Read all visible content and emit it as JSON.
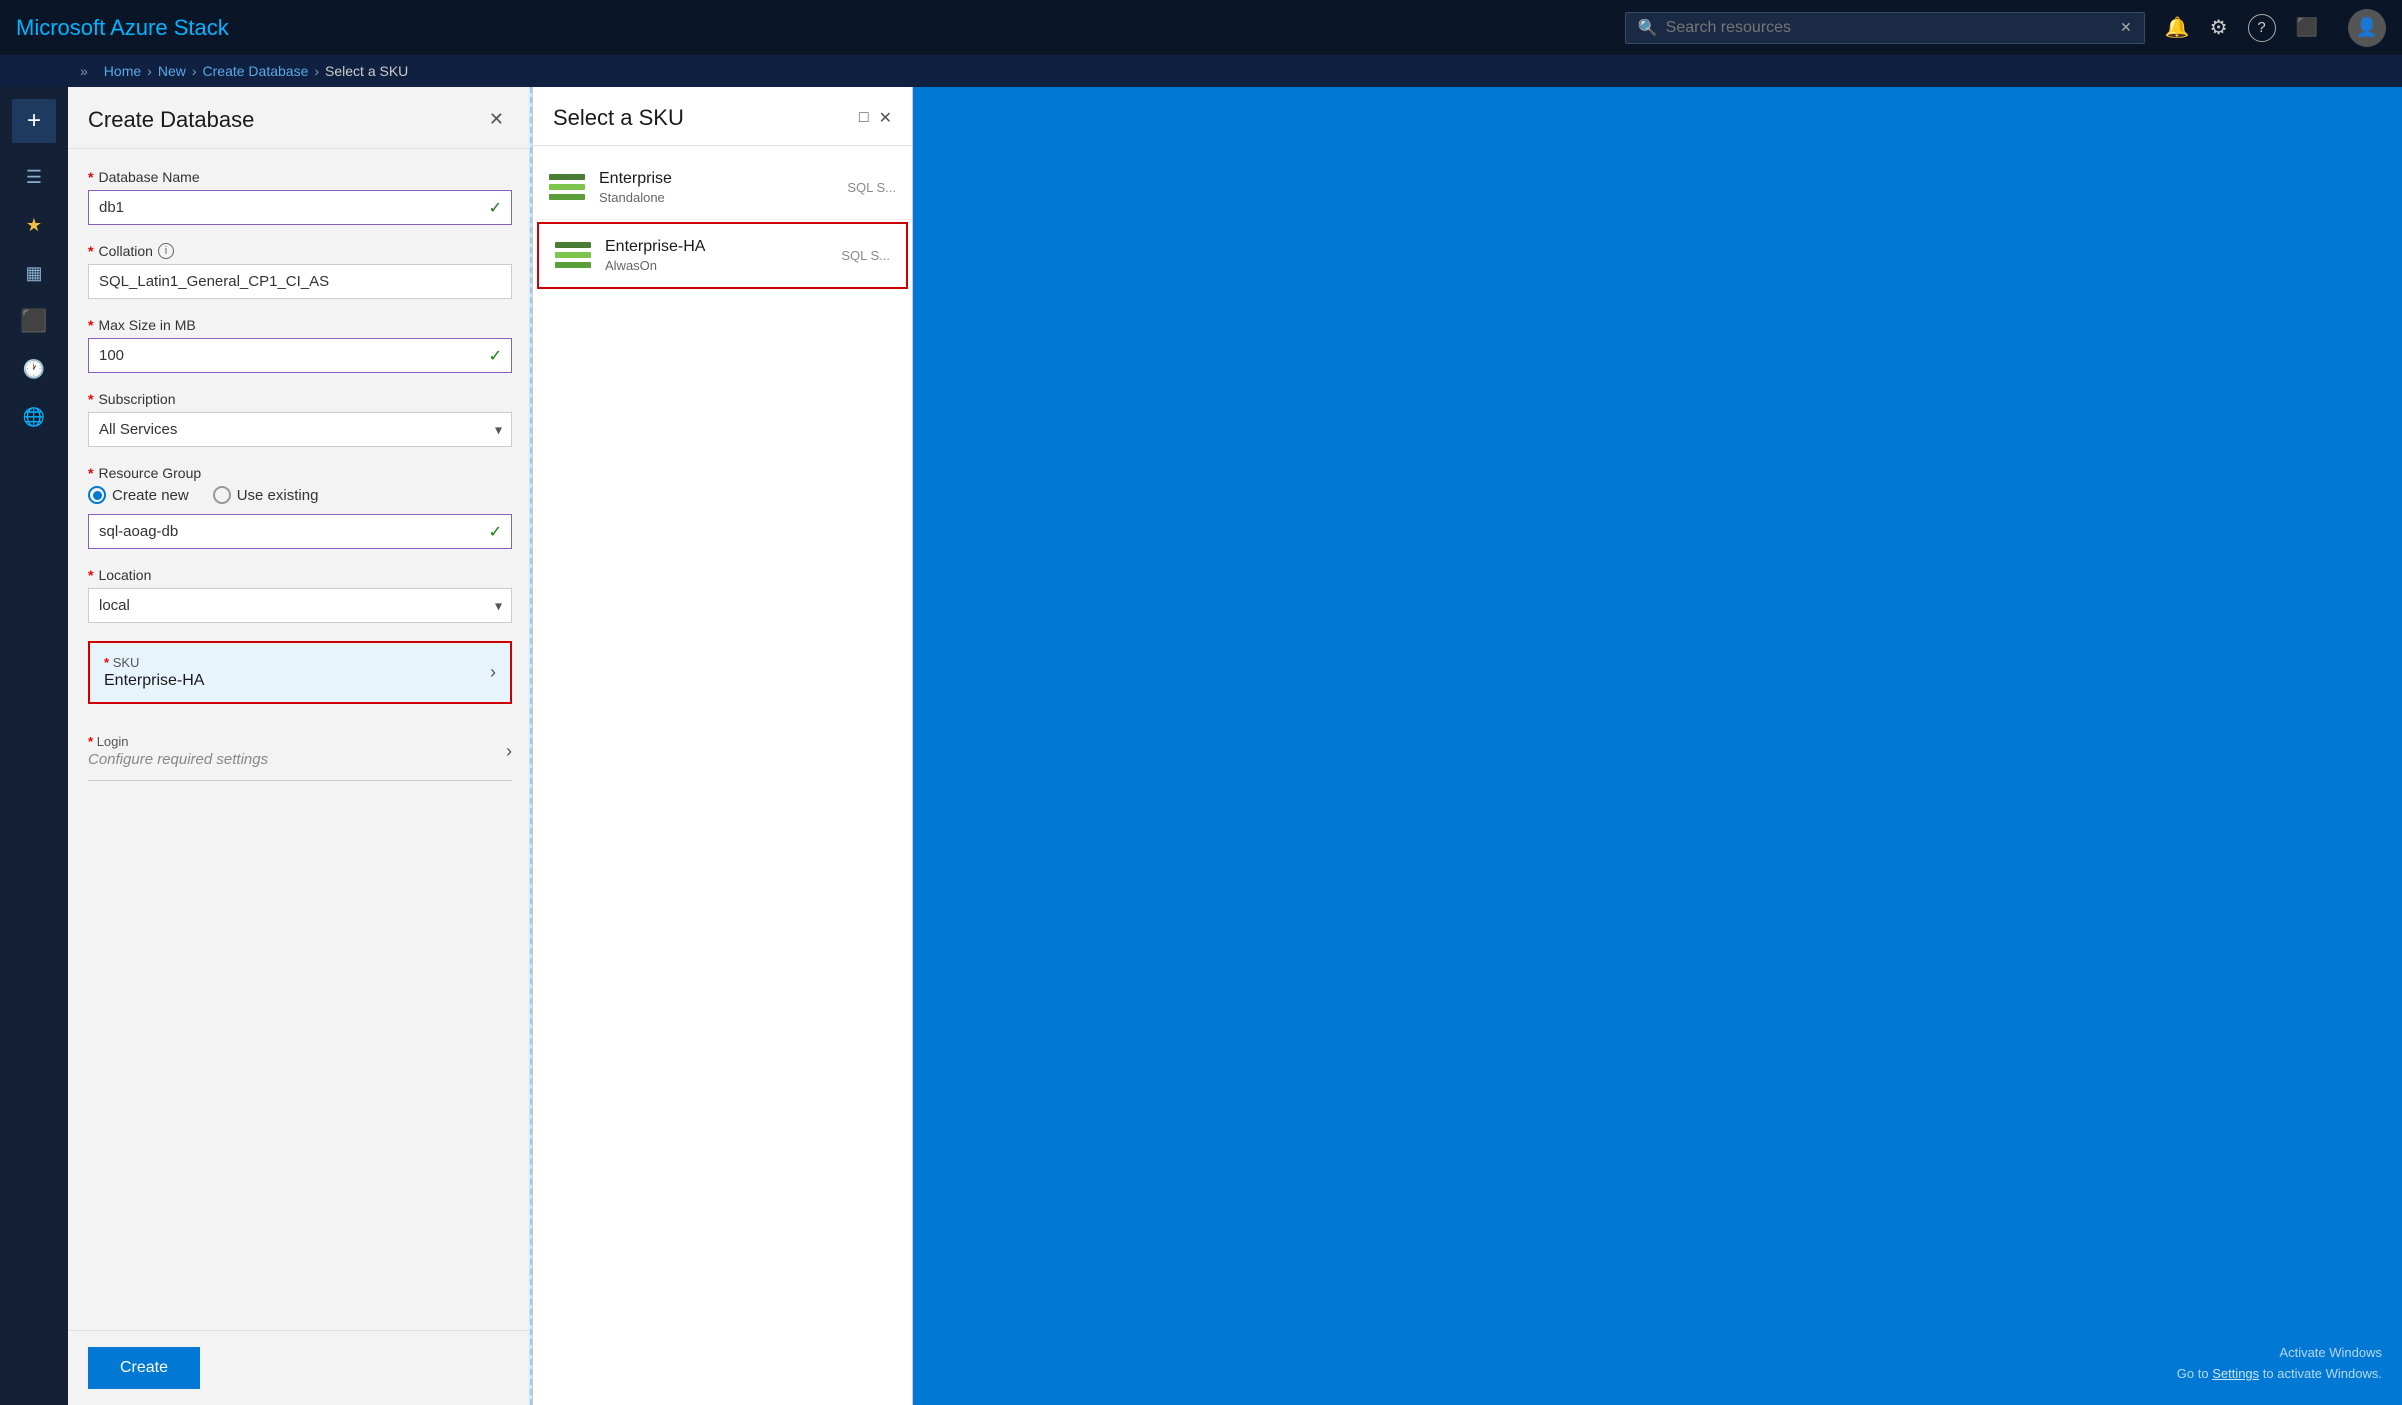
{
  "topbar": {
    "title": "Microsoft Azure Stack",
    "search_placeholder": "Search resources",
    "icons": {
      "bell": "🔔",
      "gear": "⚙",
      "help": "?",
      "portal": "⬛"
    }
  },
  "breadcrumb": {
    "expand": "»",
    "items": [
      "Home",
      "New",
      "Create Database",
      "Select a SKU"
    ]
  },
  "sidebar": {
    "add_label": "+",
    "items": [
      {
        "name": "hamburger",
        "icon": "☰"
      },
      {
        "name": "star",
        "icon": "★"
      },
      {
        "name": "dashboard",
        "icon": "▦"
      },
      {
        "name": "blocks",
        "icon": "⬛"
      },
      {
        "name": "clock",
        "icon": "🕐"
      },
      {
        "name": "globe",
        "icon": "🌐"
      }
    ]
  },
  "create_database_panel": {
    "title": "Create Database",
    "close_icon": "✕",
    "fields": {
      "database_name": {
        "label": "Database Name",
        "value": "db1",
        "placeholder": "db1"
      },
      "collation": {
        "label": "Collation",
        "info": "i",
        "value": "SQL_Latin1_General_CP1_CI_AS",
        "placeholder": ""
      },
      "max_size": {
        "label": "Max Size in MB",
        "value": "100",
        "placeholder": ""
      },
      "subscription": {
        "label": "Subscription",
        "value": "All Services",
        "options": [
          "All Services"
        ]
      },
      "resource_group": {
        "label": "Resource Group",
        "create_new": "Create new",
        "use_existing": "Use existing",
        "selected": "create_new",
        "value": "sql-aoag-db"
      },
      "location": {
        "label": "Location",
        "value": "local",
        "options": [
          "local"
        ]
      },
      "sku": {
        "label": "SKU",
        "value": "Enterprise-HA",
        "arrow": "›"
      },
      "login": {
        "label": "Login",
        "value": "Configure required settings",
        "arrow": "›"
      }
    },
    "create_button": "Create"
  },
  "sku_panel": {
    "title": "Select a SKU",
    "minimize_icon": "□",
    "close_icon": "✕",
    "items": [
      {
        "name": "Enterprise",
        "subtitle": "Standalone",
        "type": "SQL S...",
        "selected": false
      },
      {
        "name": "Enterprise-HA",
        "subtitle": "AlwasOn",
        "type": "SQL S...",
        "selected": true
      }
    ]
  },
  "activate_windows": {
    "line1": "Activate Windows",
    "line2": "Go to Settings to activate Windows."
  }
}
